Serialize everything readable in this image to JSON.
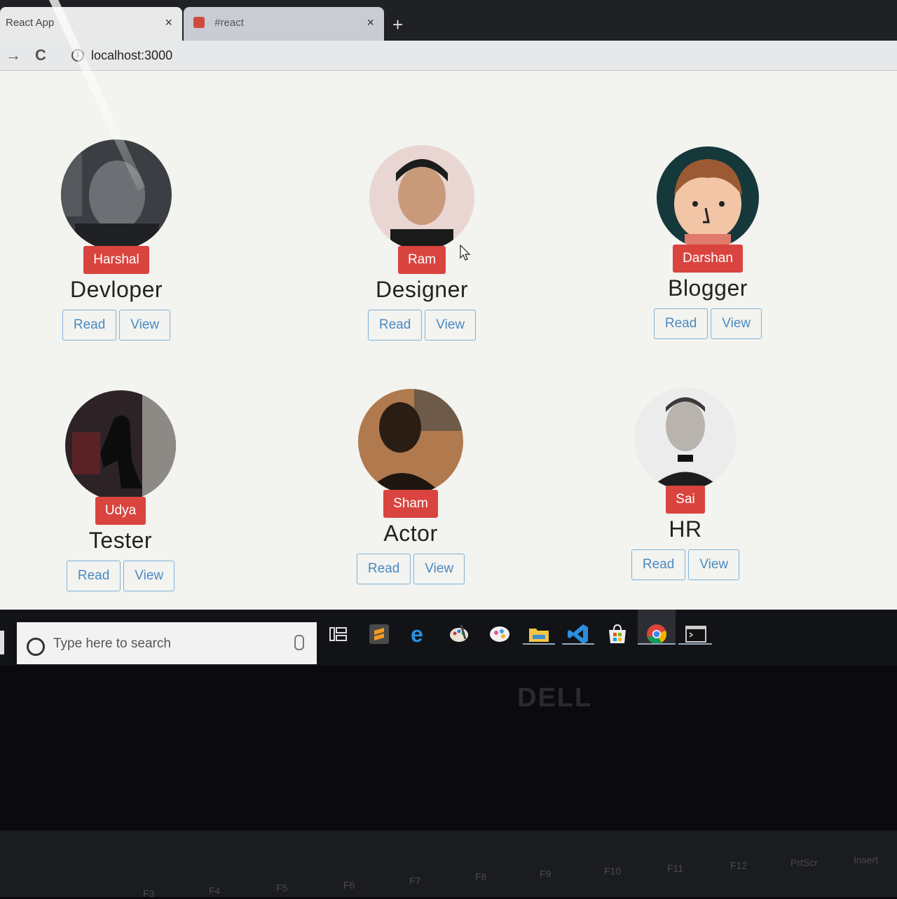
{
  "browser": {
    "tabs": [
      {
        "label": "React App",
        "close": "×"
      },
      {
        "label": "#react",
        "close": "×"
      }
    ],
    "new_tab": "+",
    "back": "→",
    "reload": "C",
    "url": "localhost:3000"
  },
  "cards": [
    {
      "name": "Harshal",
      "role": "Devloper",
      "read": "Read",
      "view": "View",
      "avatar": "person-photo"
    },
    {
      "name": "Ram",
      "role": "Designer",
      "read": "Read",
      "view": "View",
      "avatar": "person-photo"
    },
    {
      "name": "Darshan",
      "role": "Blogger",
      "read": "Read",
      "view": "View",
      "avatar": "cartoon-face"
    },
    {
      "name": "Udya",
      "role": "Tester",
      "read": "Read",
      "view": "View",
      "avatar": "silhouette-photo"
    },
    {
      "name": "Sham",
      "role": "Actor",
      "read": "Read",
      "view": "View",
      "avatar": "person-photo"
    },
    {
      "name": "Sai",
      "role": "HR",
      "read": "Read",
      "view": "View",
      "avatar": "person-photo"
    }
  ],
  "taskbar": {
    "search_placeholder": "Type here to search",
    "icons": [
      "task-view-icon",
      "sublime-text-icon",
      "edge-icon",
      "paint-icon",
      "paint3d-icon",
      "file-explorer-icon",
      "vscode-icon",
      "store-icon",
      "chrome-icon",
      "terminal-icon"
    ]
  },
  "laptop": {
    "brand": "DELL",
    "fkeys": [
      "F3",
      "F4",
      "F5",
      "F6",
      "F7",
      "F8",
      "F9",
      "F10",
      "F11",
      "F12",
      "PrtScr",
      "Insert"
    ]
  },
  "colors": {
    "badge": "#d9443f",
    "button_border": "#7fb3d8",
    "button_text": "#4a8ac2"
  }
}
